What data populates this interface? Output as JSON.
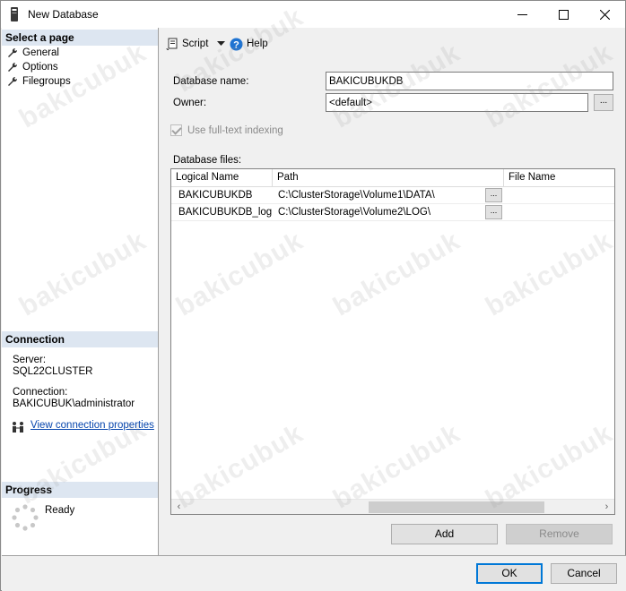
{
  "window": {
    "title": "New Database"
  },
  "left_pane": {
    "select_page_header": "Select a page",
    "pages": [
      {
        "label": "General",
        "icon": "wrench-icon"
      },
      {
        "label": "Options",
        "icon": "wrench-icon"
      },
      {
        "label": "Filegroups",
        "icon": "wrench-icon"
      }
    ],
    "connection_header": "Connection",
    "server_label": "Server:",
    "server_value": "SQL22CLUSTER",
    "connection_label": "Connection:",
    "connection_value": "BAKICUBUK\\administrator",
    "view_connection_link": "View connection properties",
    "progress_header": "Progress",
    "progress_status": "Ready"
  },
  "toolbar": {
    "script_label": "Script",
    "help_label": "Help"
  },
  "form": {
    "database_name_label": "Database name:",
    "database_name_value": "BAKICUBUKDB",
    "owner_label": "Owner:",
    "owner_value": "<default>",
    "fulltext_label": "Use full-text indexing",
    "database_files_label": "Database files:",
    "browse_button": "..."
  },
  "files_grid": {
    "columns": [
      "Logical Name",
      "Path",
      "File Name"
    ],
    "rows": [
      {
        "logical_name": "BAKICUBUKDB",
        "path": "C:\\ClusterStorage\\Volume1\\DATA\\"
      },
      {
        "logical_name": "BAKICUBUKDB_log",
        "path": "C:\\ClusterStorage\\Volume2\\LOG\\"
      }
    ]
  },
  "buttons": {
    "add": "Add",
    "remove": "Remove",
    "ok": "OK",
    "cancel": "Cancel"
  },
  "watermark_text": "bakicubuk",
  "colors": {
    "section_header_bg": "#dde6f1",
    "link": "#0645ad",
    "default_button_border": "#0078d7"
  }
}
